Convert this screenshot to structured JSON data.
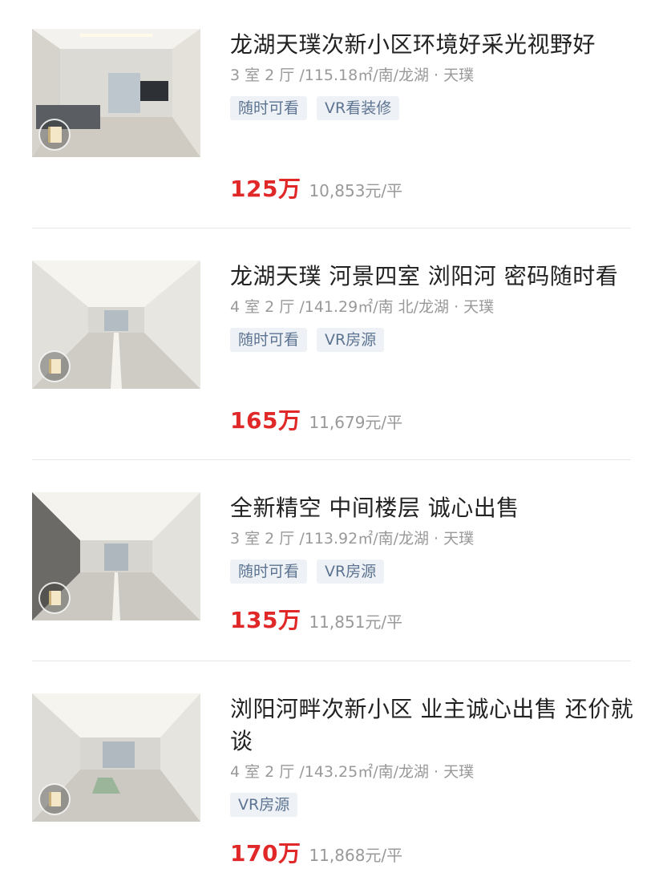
{
  "listings": [
    {
      "title": "龙湖天璞次新小区环境好采光视野好",
      "meta": "3 室 2 厅 /115.18㎡/南/龙湖 · 天璞",
      "tags": [
        "随时可看",
        "VR看装修"
      ],
      "price": "125万",
      "unit_price": "10,853元/平",
      "thumb_icon": "play-pause-icon"
    },
    {
      "title": "龙湖天璞 河景四室 浏阳河 密码随时看",
      "meta": "4 室 2 厅 /141.29㎡/南 北/龙湖 · 天璞",
      "tags": [
        "随时可看",
        "VR房源"
      ],
      "price": "165万",
      "unit_price": "11,679元/平",
      "thumb_icon": "vr-cube-icon"
    },
    {
      "title": "全新精空 中间楼层  诚心出售",
      "meta": "3 室 2 厅 /113.92㎡/南/龙湖 · 天璞",
      "tags": [
        "随时可看",
        "VR房源"
      ],
      "price": "135万",
      "unit_price": "11,851元/平",
      "thumb_icon": "vr-cube-icon"
    },
    {
      "title": "浏阳河畔次新小区  业主诚心出售 还价就谈",
      "meta": "4 室 2 厅 /143.25㎡/南/龙湖 · 天璞",
      "tags": [
        "VR房源"
      ],
      "price": "170万",
      "unit_price": "11,868元/平",
      "thumb_icon": "vr-cube-icon"
    }
  ],
  "colors": {
    "price": "#e02828",
    "tag_bg": "#eef2f6",
    "tag_text": "#5c7391",
    "meta": "#999999"
  }
}
